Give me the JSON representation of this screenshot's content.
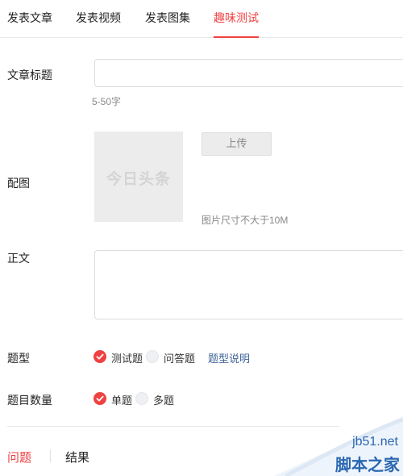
{
  "tabs": [
    {
      "label": "发表文章",
      "active": false
    },
    {
      "label": "发表视频",
      "active": false
    },
    {
      "label": "发表图集",
      "active": false
    },
    {
      "label": "趣味测试",
      "active": true
    }
  ],
  "form": {
    "title_label": "文章标题",
    "title_value": "",
    "title_hint": "5-50字",
    "image_label": "配图",
    "image_placeholder_logo": "今日头条",
    "upload_label": "上传",
    "image_hint": "图片尺寸不大于10M",
    "body_label": "正文",
    "body_value": "",
    "type_label": "题型",
    "type_options": [
      {
        "label": "测试题",
        "checked": true
      },
      {
        "label": "问答题",
        "checked": false
      }
    ],
    "type_help_link": "题型说明",
    "count_label": "题目数量",
    "count_options": [
      {
        "label": "单题",
        "checked": true
      },
      {
        "label": "多题",
        "checked": false
      }
    ]
  },
  "bottom_tabs": [
    {
      "label": "问题",
      "active": true
    },
    {
      "label": "结果",
      "active": false
    }
  ],
  "watermark": {
    "domain": "jb51.net",
    "name": "脚本之家"
  },
  "colors": {
    "accent": "#f04142",
    "link": "#406599",
    "watermark": "#2a67b1"
  }
}
